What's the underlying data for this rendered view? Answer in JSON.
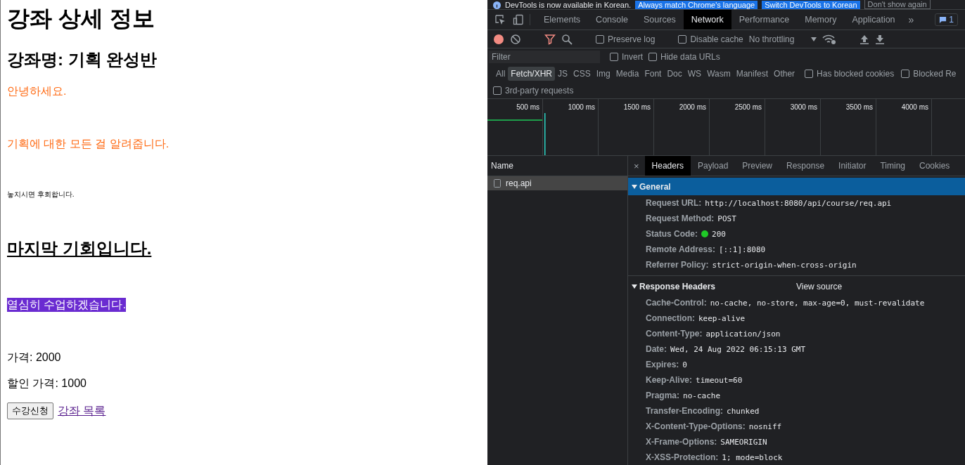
{
  "page": {
    "content": [
      {
        "kind": "title",
        "text": "강좌 상세 정보"
      },
      {
        "kind": "subtitle",
        "text": "강좌명: 기획 완성반"
      },
      {
        "kind": "accent",
        "text": "안녕하세요."
      },
      {
        "kind": "accent",
        "text": "기획에 대한 모든 걸 알려줍니다."
      },
      {
        "kind": "small",
        "text": "놓치시면 후회합니다."
      },
      {
        "kind": "heading",
        "text": "마지막 기회입니다."
      },
      {
        "kind": "highlight",
        "text": "열심히 수업하겠습니다."
      },
      {
        "kind": "text",
        "text": "가격: 2000"
      },
      {
        "kind": "text",
        "text": "할인 가격: 1000"
      }
    ],
    "button": "수강신청",
    "link": "강좌 목록"
  },
  "devtools": {
    "infobar": {
      "message": "DevTools is now available in Korean.",
      "buttons": [
        "Always match Chrome's language",
        "Switch DevTools to Korean",
        "Don't show again"
      ]
    },
    "tabs": [
      {
        "label": "Elements",
        "selected": false
      },
      {
        "label": "Console",
        "selected": false
      },
      {
        "label": "Sources",
        "selected": false
      },
      {
        "label": "Network",
        "selected": true
      },
      {
        "label": "Performance",
        "selected": false
      },
      {
        "label": "Memory",
        "selected": false
      },
      {
        "label": "Application",
        "selected": false
      }
    ],
    "more": "»",
    "message_count": "1",
    "toolbar": {
      "recording": true,
      "checkboxes": [
        {
          "label": "Preserve log",
          "checked": false
        },
        {
          "label": "Disable cache",
          "checked": false
        }
      ],
      "throttling": "No throttling"
    },
    "filter": {
      "placeholder": "Filter",
      "checkboxes": [
        {
          "label": "Invert",
          "checked": false
        },
        {
          "label": "Hide data URLs",
          "checked": false
        }
      ]
    },
    "types": [
      {
        "label": "All",
        "selected": false
      },
      {
        "label": "Fetch/XHR",
        "selected": true
      },
      {
        "label": "JS",
        "selected": false
      },
      {
        "label": "CSS",
        "selected": false
      },
      {
        "label": "Img",
        "selected": false
      },
      {
        "label": "Media",
        "selected": false
      },
      {
        "label": "Font",
        "selected": false
      },
      {
        "label": "Doc",
        "selected": false
      },
      {
        "label": "WS",
        "selected": false
      },
      {
        "label": "Wasm",
        "selected": false
      },
      {
        "label": "Manifest",
        "selected": false
      },
      {
        "label": "Other",
        "selected": false
      }
    ],
    "type_checkboxes": [
      {
        "label": "Has blocked cookies",
        "checked": false
      },
      {
        "label": "Blocked Re",
        "checked": false
      }
    ],
    "third_party": {
      "label": "3rd-party requests",
      "checked": false
    },
    "timeline_ticks": [
      "500 ms",
      "1000 ms",
      "1500 ms",
      "2000 ms",
      "2500 ms",
      "3000 ms",
      "3500 ms",
      "4000 ms"
    ],
    "name_header": "Name",
    "requests": [
      {
        "name": "req.api",
        "selected": true
      }
    ],
    "detail_tabs": [
      {
        "label": "Headers",
        "selected": true
      },
      {
        "label": "Payload",
        "selected": false
      },
      {
        "label": "Preview",
        "selected": false
      },
      {
        "label": "Response",
        "selected": false
      },
      {
        "label": "Initiator",
        "selected": false
      },
      {
        "label": "Timing",
        "selected": false
      },
      {
        "label": "Cookies",
        "selected": false
      }
    ],
    "close": "×",
    "sections": [
      {
        "title": "General",
        "expanded": true,
        "highlighted": true,
        "rows": [
          {
            "key": "Request URL:",
            "value": "http://localhost:8080/api/course/req.api"
          },
          {
            "key": "Request Method:",
            "value": "POST"
          },
          {
            "key": "Status Code:",
            "value": "200",
            "kind": "status"
          },
          {
            "key": "Remote Address:",
            "value": "[::1]:8080"
          },
          {
            "key": "Referrer Policy:",
            "value": "strict-origin-when-cross-origin"
          }
        ]
      },
      {
        "title": "Response Headers",
        "expanded": true,
        "highlighted": false,
        "action": "View source",
        "rows": [
          {
            "key": "Cache-Control:",
            "value": "no-cache, no-store, max-age=0, must-revalidate"
          },
          {
            "key": "Connection:",
            "value": "keep-alive"
          },
          {
            "key": "Content-Type:",
            "value": "application/json"
          },
          {
            "key": "Date:",
            "value": "Wed, 24 Aug 2022 06:15:13 GMT"
          },
          {
            "key": "Expires:",
            "value": "0"
          },
          {
            "key": "Keep-Alive:",
            "value": "timeout=60"
          },
          {
            "key": "Pragma:",
            "value": "no-cache"
          },
          {
            "key": "Transfer-Encoding:",
            "value": "chunked"
          },
          {
            "key": "X-Content-Type-Options:",
            "value": "nosniff"
          },
          {
            "key": "X-Frame-Options:",
            "value": "SAMEORIGIN"
          },
          {
            "key": "X-XSS-Protection:",
            "value": "1; mode=block"
          }
        ]
      }
    ]
  }
}
